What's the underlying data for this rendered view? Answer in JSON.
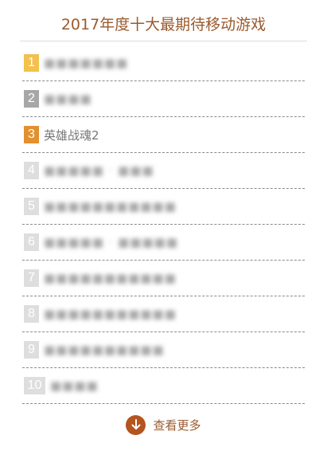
{
  "title": "2017年度十大最期待移动游戏",
  "colors": {
    "title": "#9a5a2e",
    "rank_gold": "#f2c14e",
    "rank_silver": "#a7a7a7",
    "rank_bronze": "#e3902f",
    "rank_other": "#dedede",
    "more_icon": "#b4541f"
  },
  "items": [
    {
      "rank": "1",
      "name": "",
      "blurred": true,
      "rank_color": "#f2c14e"
    },
    {
      "rank": "2",
      "name": "",
      "blurred": true,
      "rank_color": "#a7a7a7"
    },
    {
      "rank": "3",
      "name": "英雄战魂2",
      "blurred": false,
      "rank_color": "#e3902f"
    },
    {
      "rank": "4",
      "name": "",
      "blurred": true,
      "rank_color": "#dedede"
    },
    {
      "rank": "5",
      "name": "",
      "blurred": true,
      "rank_color": "#dedede"
    },
    {
      "rank": "6",
      "name": "",
      "blurred": true,
      "rank_color": "#dedede"
    },
    {
      "rank": "7",
      "name": "",
      "blurred": true,
      "rank_color": "#dedede"
    },
    {
      "rank": "8",
      "name": "",
      "blurred": true,
      "rank_color": "#dedede"
    },
    {
      "rank": "9",
      "name": "",
      "blurred": true,
      "rank_color": "#dedede"
    },
    {
      "rank": "10",
      "name": "",
      "blurred": true,
      "rank_color": "#dedede"
    }
  ],
  "more": {
    "label": "查看更多",
    "icon": "arrow-down-circle-icon"
  }
}
